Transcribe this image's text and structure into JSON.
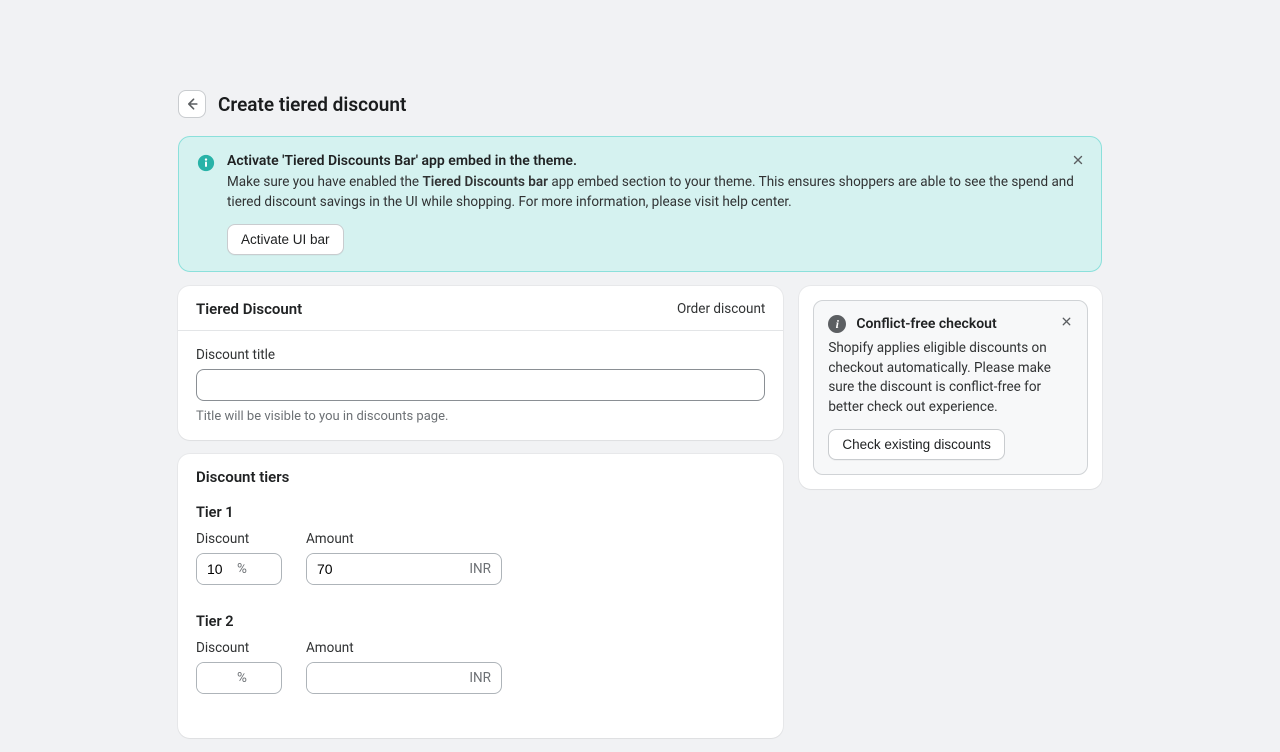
{
  "header": {
    "title": "Create tiered discount"
  },
  "banner": {
    "title": "Activate 'Tiered Discounts Bar' app embed in the theme.",
    "text_pre": "Make sure you have enabled the ",
    "text_strong": "Tiered Discounts bar",
    "text_post": " app embed section to your theme. This ensures shoppers are able to see the spend and tiered discount savings in the UI while shopping. For more information, please visit help center.",
    "button": "Activate UI bar"
  },
  "discount_card": {
    "title": "Tiered Discount",
    "type": "Order discount",
    "field_label": "Discount title",
    "field_value": "",
    "help": "Title will be visible to you in discounts page."
  },
  "tiers_card": {
    "title": "Discount tiers",
    "discount_label": "Discount",
    "amount_label": "Amount",
    "percent_suffix": "%",
    "currency_suffix": "INR",
    "tiers": [
      {
        "name": "Tier 1",
        "discount": "10",
        "amount": "70"
      },
      {
        "name": "Tier 2",
        "discount": "",
        "amount": ""
      }
    ]
  },
  "side": {
    "title": "Conflict-free checkout",
    "text": "Shopify applies eligible discounts on checkout automatically. Please make sure the discount is conflict-free for better check out experience.",
    "button": "Check existing discounts"
  }
}
